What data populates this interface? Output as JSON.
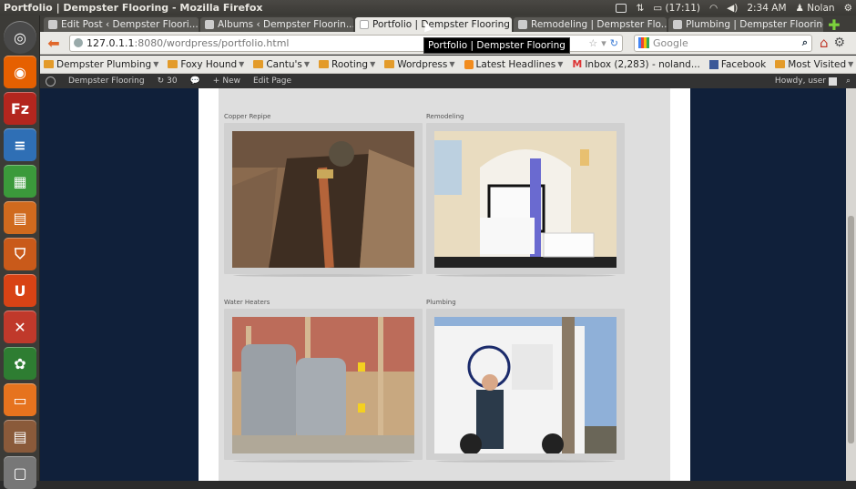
{
  "panel": {
    "title": "Portfolio | Dempster Flooring - Mozilla Firefox",
    "battery": "(17:11)",
    "time": "2:34 AM",
    "user": "Nolan"
  },
  "tabs": [
    {
      "label": "Edit Post ‹ Dempster Floori..."
    },
    {
      "label": "Albums ‹ Dempster Floorin..."
    },
    {
      "label": "Portfolio | Dempster Flooring"
    },
    {
      "label": "Remodeling | Dempster Flo..."
    },
    {
      "label": "Plumbing | Dempster Flooring"
    }
  ],
  "nav": {
    "url_host": "127.0.1.1",
    "url_path": ":8080/wordpress/portfolio.html",
    "search_placeholder": "Google"
  },
  "tooltip": "Portfolio | Dempster Flooring",
  "bookmarks": [
    {
      "label": "Dempster Plumbing",
      "icon": "folder-icon",
      "dropdown": true
    },
    {
      "label": "Foxy Hound",
      "icon": "folder-icon",
      "dropdown": true
    },
    {
      "label": "Cantu's",
      "icon": "folder-icon",
      "dropdown": true
    },
    {
      "label": "Rooting",
      "icon": "folder-icon",
      "dropdown": true
    },
    {
      "label": "Wordpress",
      "icon": "folder-icon",
      "dropdown": true
    },
    {
      "label": "Latest Headlines",
      "icon": "rss-icon",
      "dropdown": true
    },
    {
      "label": "Inbox (2,283) - noland...",
      "icon": "gmail-icon",
      "dropdown": false
    },
    {
      "label": "Facebook",
      "icon": "facebook-icon",
      "dropdown": false
    },
    {
      "label": "Most Visited",
      "icon": "folder-icon",
      "dropdown": true
    }
  ],
  "wpbar": {
    "site": "Dempster Flooring",
    "updates": "30",
    "new_label": "New",
    "edit_label": "Edit Page",
    "howdy": "Howdy, user"
  },
  "portfolio": {
    "items": [
      {
        "title": "Copper Repipe"
      },
      {
        "title": "Remodeling"
      },
      {
        "title": "Water Heaters"
      },
      {
        "title": "Plumbing"
      }
    ]
  },
  "colors": {
    "page_bg": "#10203a",
    "accent_orange": "#e0672a"
  }
}
